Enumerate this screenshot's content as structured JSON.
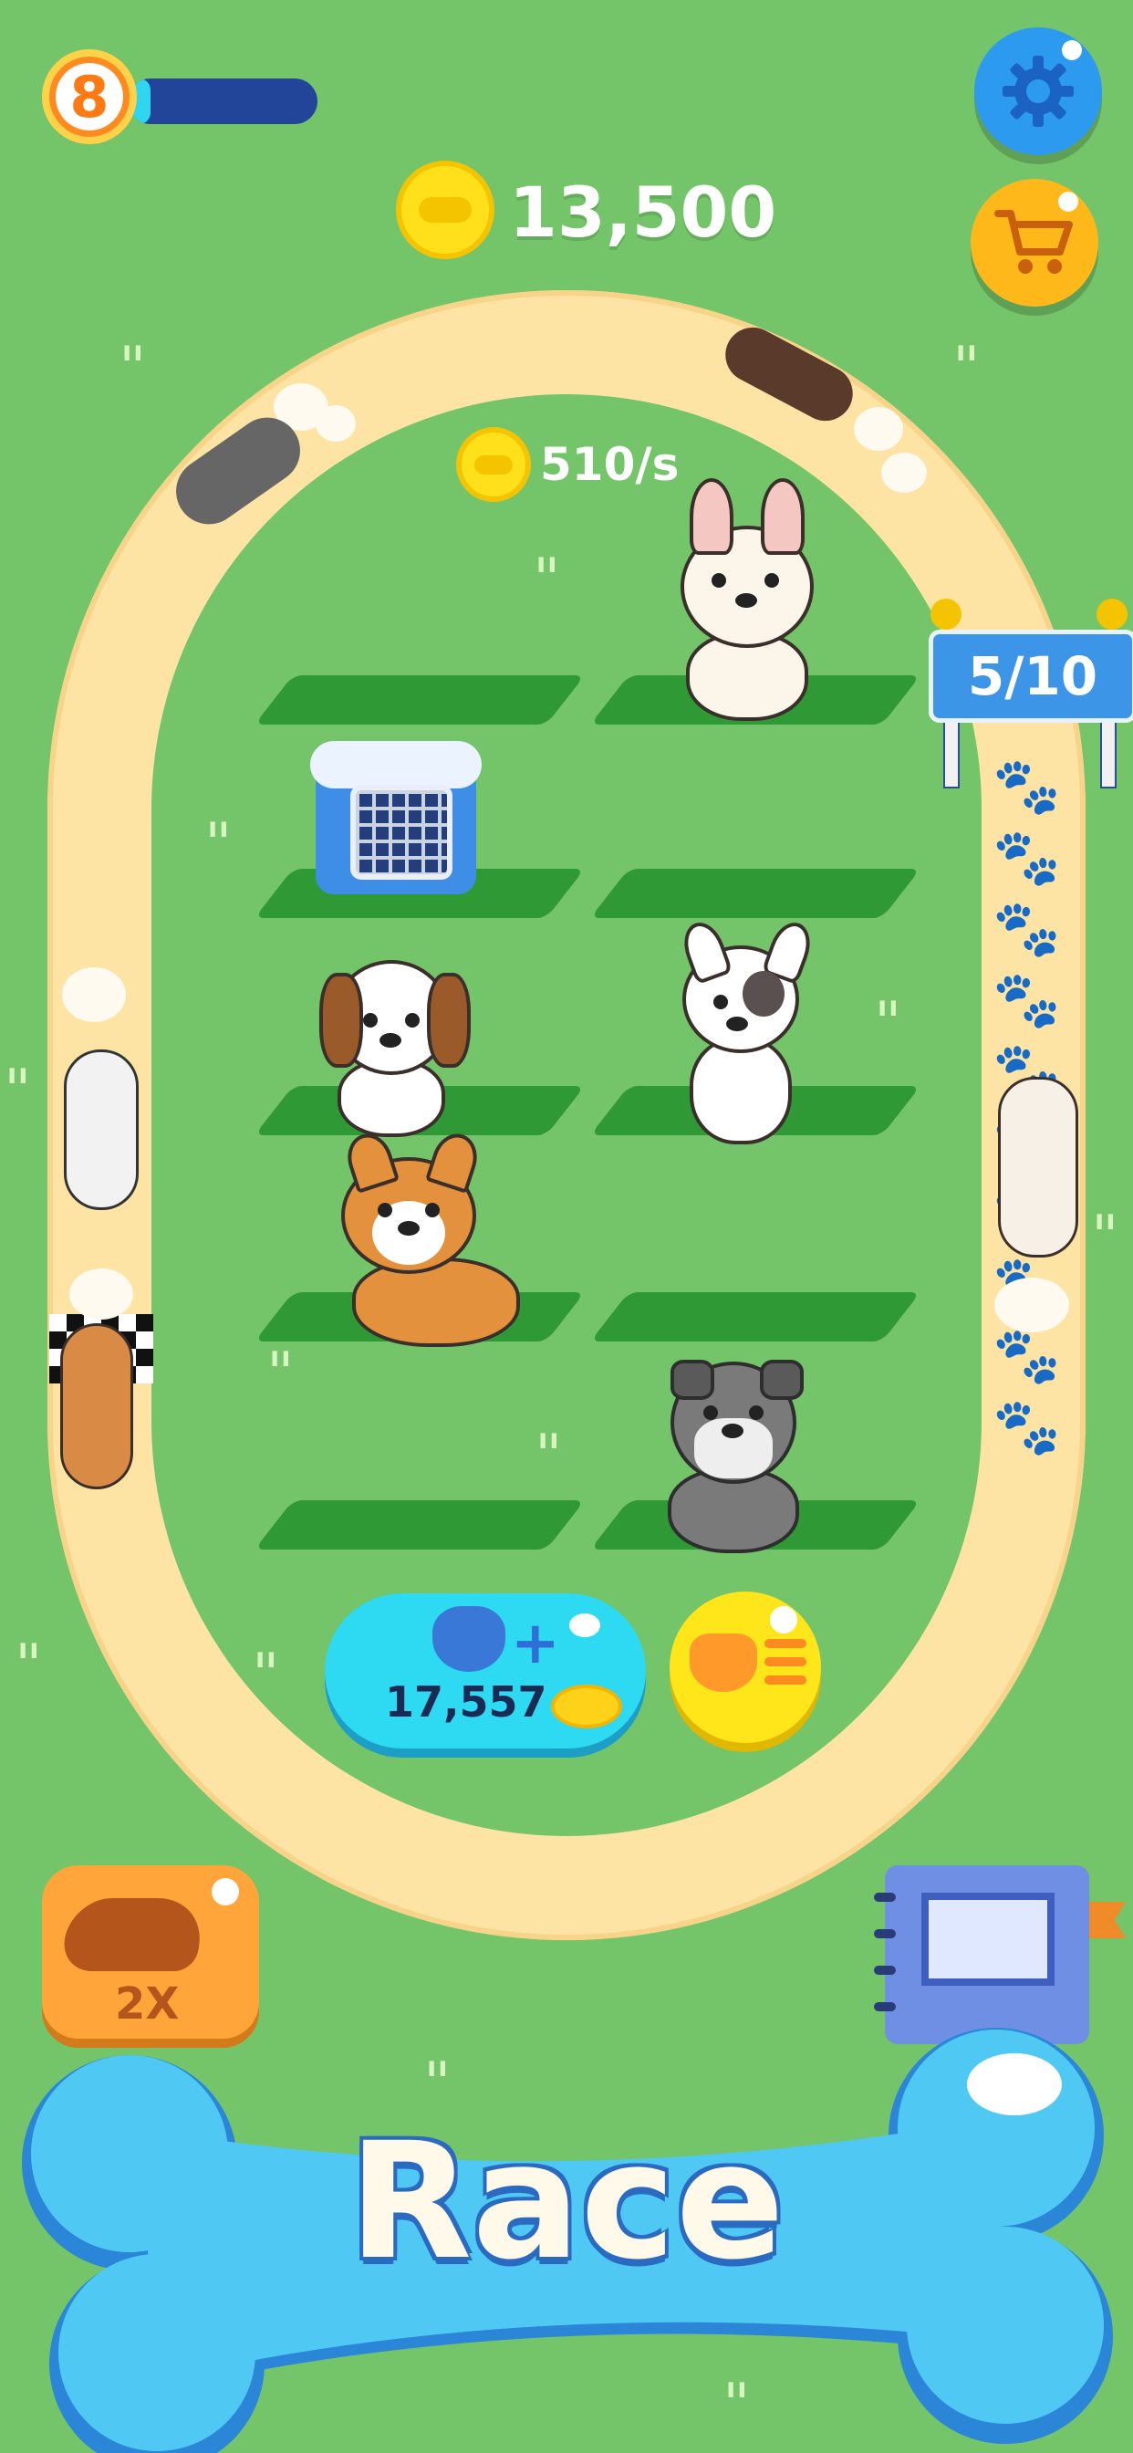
{
  "hud": {
    "level": "8",
    "xp_progress": 0.12,
    "coin_total": "13,500",
    "coin_rate": "510/s",
    "settings_icon": "gear-icon",
    "shop_icon": "cart-icon"
  },
  "track": {
    "lap_counter": "5/10",
    "paws_filled": 5,
    "paws_total": 10
  },
  "buy_dog": {
    "price": "17,557",
    "icon": "dog-plus-icon"
  },
  "dog_list": {
    "icon": "dog-list-icon"
  },
  "speed_boost": {
    "label": "2X"
  },
  "album": {
    "icon": "album-icon"
  },
  "race_button": {
    "label": "Race"
  },
  "colors": {
    "grass": "#74c46a",
    "track": "#fde4a4",
    "slot": "#2f9a35",
    "accent_blue": "#2c9bef",
    "coin_yellow": "#ffe01a"
  }
}
